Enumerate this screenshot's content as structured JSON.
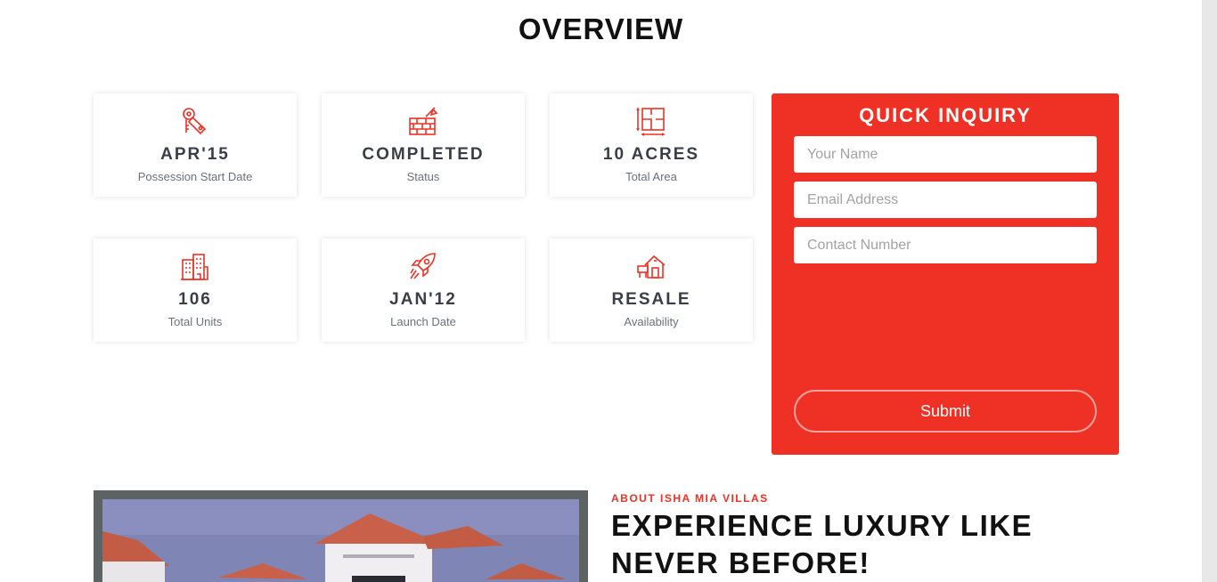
{
  "overview": {
    "title": "OVERVIEW",
    "cards": [
      {
        "icon": "keys-tag-icon",
        "value": "APR'15",
        "label": "Possession Start Date"
      },
      {
        "icon": "brick-wall-trowel-icon",
        "value": "COMPLETED",
        "label": "Status"
      },
      {
        "icon": "floor-plan-icon",
        "value": "10 ACRES",
        "label": "Total Area"
      },
      {
        "icon": "buildings-icon",
        "value": "106",
        "label": "Total Units"
      },
      {
        "icon": "rocket-icon",
        "value": "JAN'12",
        "label": "Launch Date"
      },
      {
        "icon": "house-sale-icon",
        "value": "RESALE",
        "label": "Availability"
      }
    ]
  },
  "inquiry": {
    "title": "QUICK INQUIRY",
    "name_placeholder": "Your Name",
    "email_placeholder": "Email Address",
    "phone_placeholder": "Contact Number",
    "submit_label": "Submit"
  },
  "about": {
    "eyebrow": "ABOUT ISHA MIA VILLAS",
    "headline": "EXPERIENCE LUXURY LIKE NEVER BEFORE!"
  },
  "colors": {
    "accent": "#ee3124",
    "text_dark": "#3a3f47",
    "text_muted": "#6b7079"
  }
}
